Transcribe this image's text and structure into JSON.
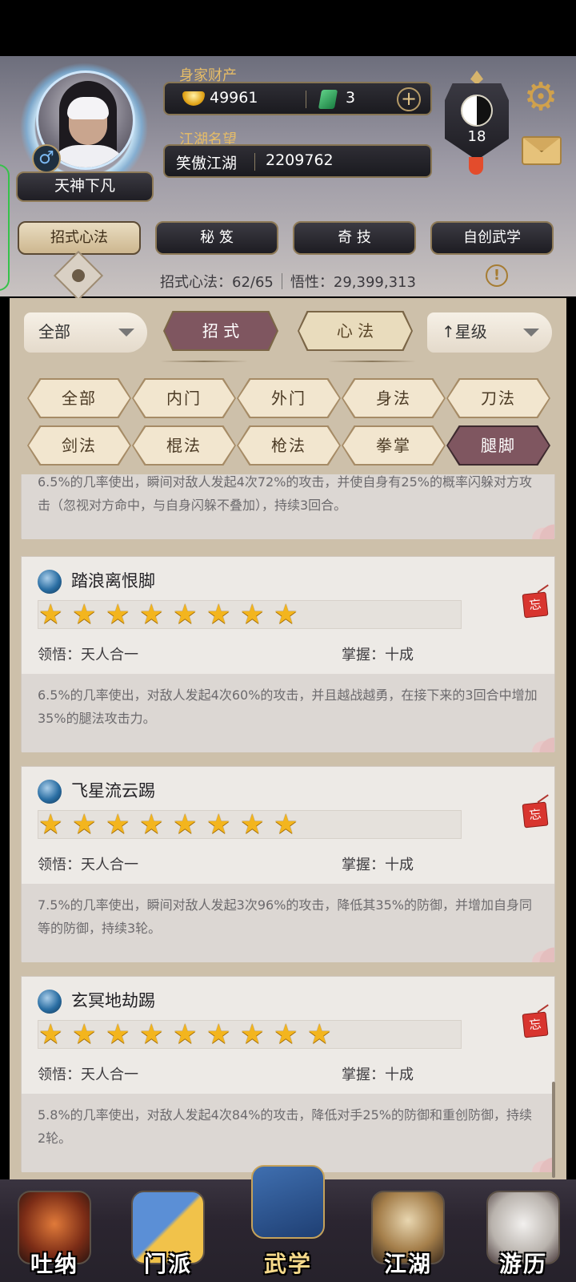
{
  "header": {
    "wealth_label": "身家财产",
    "gold": "49961",
    "jade": "3",
    "fame_label": "江湖名望",
    "fame_title": "笑傲江湖",
    "fame_value": "2209762",
    "player_name": "天神下凡",
    "gender_symbol": "♂",
    "rank_level": "18",
    "plus_symbol": "+"
  },
  "main_tabs": [
    {
      "label": "招式心法",
      "active": true
    },
    {
      "label": "秘 笈",
      "active": false
    },
    {
      "label": "奇 技",
      "active": false
    },
    {
      "label": "自创武学",
      "active": false
    }
  ],
  "stats": {
    "moves_label": "招式心法：62/65",
    "insight_label": "悟性：29,399,313"
  },
  "filters": {
    "category_dropdown": "全部",
    "type_toggles": [
      {
        "label": "招 式",
        "active": true
      },
      {
        "label": "心 法",
        "active": false
      }
    ],
    "sort_dropdown": "↑星级",
    "school_filters": [
      {
        "label": "全部",
        "active": false
      },
      {
        "label": "内门",
        "active": false
      },
      {
        "label": "外门",
        "active": false
      },
      {
        "label": "身法",
        "active": false
      },
      {
        "label": "刀法",
        "active": false
      },
      {
        "label": "剑法",
        "active": false
      },
      {
        "label": "棍法",
        "active": false
      },
      {
        "label": "枪法",
        "active": false
      },
      {
        "label": "拳掌",
        "active": false
      },
      {
        "label": "腿脚",
        "active": true
      }
    ]
  },
  "skills": {
    "partial_desc": "6.5%的几率使出，瞬间对敌人发起4次72%的攻击，并使自身有25%的概率闪躲对方攻击（忽视对方命中，与自身闪躲不叠加），持续3回合。",
    "items": [
      {
        "name": "踏浪离恨脚",
        "stars": 8,
        "comprehension": "领悟：天人合一",
        "mastery": "掌握：十成",
        "forget": "忘",
        "description": "6.5%的几率使出，对敌人发起4次60%的攻击，并且越战越勇，在接下来的3回合中增加35%的腿法攻击力。"
      },
      {
        "name": "飞星流云踢",
        "stars": 8,
        "comprehension": "领悟：天人合一",
        "mastery": "掌握：十成",
        "forget": "忘",
        "description": "7.5%的几率使出，瞬间对敌人发起3次96%的攻击，降低其35%的防御，并增加自身同等的防御，持续3轮。"
      },
      {
        "name": "玄冥地劫踢",
        "stars": 9,
        "comprehension": "领悟：天人合一",
        "mastery": "掌握：十成",
        "forget": "忘",
        "description": "5.8%的几率使出，对敌人发起4次84%的攻击，降低对手25%的防御和重创防御，持续2轮。"
      }
    ]
  },
  "bottom_nav": [
    {
      "label": "吐纳",
      "active": false
    },
    {
      "label": "门派",
      "active": false
    },
    {
      "label": "武学",
      "active": true
    },
    {
      "label": "江湖",
      "active": false
    },
    {
      "label": "游历",
      "active": false
    }
  ],
  "colors": {
    "accent_gold": "#e7bd66",
    "active_tab": "#7f5660",
    "star": "#f3b51e"
  }
}
